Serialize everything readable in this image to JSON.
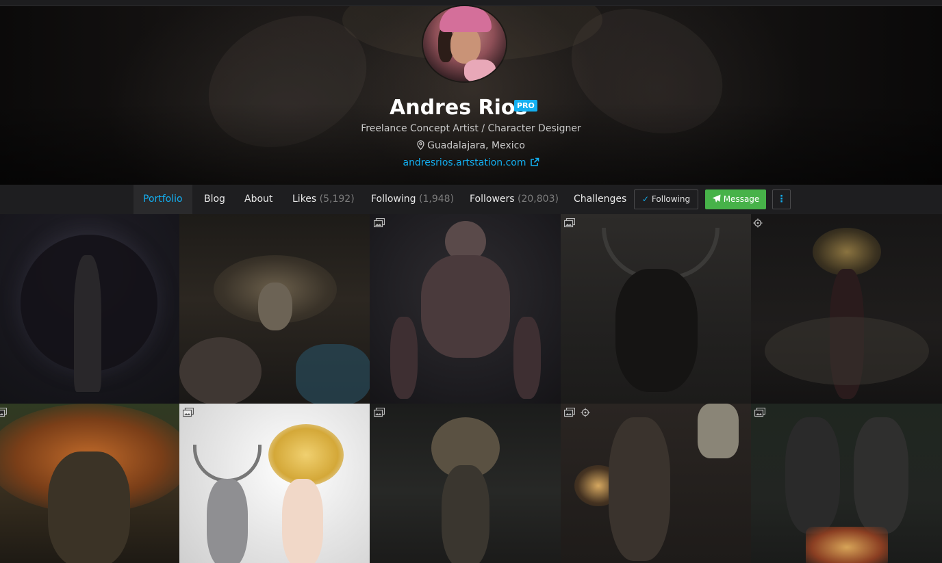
{
  "profile": {
    "name": "Andres Rios",
    "badge": "PRO",
    "tagline": "Freelance Concept Artist / Character Designer",
    "location": "Guadalajara, Mexico",
    "website": "andresrios.artstation.com"
  },
  "nav": {
    "items": [
      {
        "label": "Portfolio",
        "count": "",
        "active": true
      },
      {
        "label": "Blog",
        "count": ""
      },
      {
        "label": "About",
        "count": ""
      },
      {
        "label": "Likes",
        "count": "(5,192)"
      },
      {
        "label": "Following",
        "count": "(1,948)"
      },
      {
        "label": "Followers",
        "count": "(20,803)"
      },
      {
        "label": "Challenges",
        "count": ""
      }
    ],
    "following_button": "Following",
    "message_button": "Message",
    "more_button": "⋮"
  },
  "colors": {
    "accent": "#13aff0",
    "message_green": "#47b249",
    "navbar": "#1e1e20",
    "background": "#121212"
  },
  "icons": {
    "location": "map-pin-icon",
    "external_link": "external-link-icon",
    "following_check": "check-icon",
    "message": "paper-plane-icon",
    "more": "vertical-dots-icon",
    "gallery": "image-stack-icon",
    "rotate_360": "rotate-360-icon"
  },
  "gallery": {
    "rows": [
      [
        {
          "icons": []
        },
        {
          "icons": []
        },
        {
          "icons": [
            "image-stack-icon"
          ]
        },
        {
          "icons": [
            "image-stack-icon"
          ]
        },
        {
          "icons": [
            "rotate-360-icon"
          ]
        }
      ],
      [
        {
          "icons": [
            "image-stack-icon"
          ]
        },
        {
          "icons": [
            "image-stack-icon"
          ]
        },
        {
          "icons": [
            "image-stack-icon"
          ]
        },
        {
          "icons": [
            "image-stack-icon",
            "rotate-360-icon"
          ]
        },
        {
          "icons": [
            "image-stack-icon"
          ]
        }
      ]
    ]
  }
}
